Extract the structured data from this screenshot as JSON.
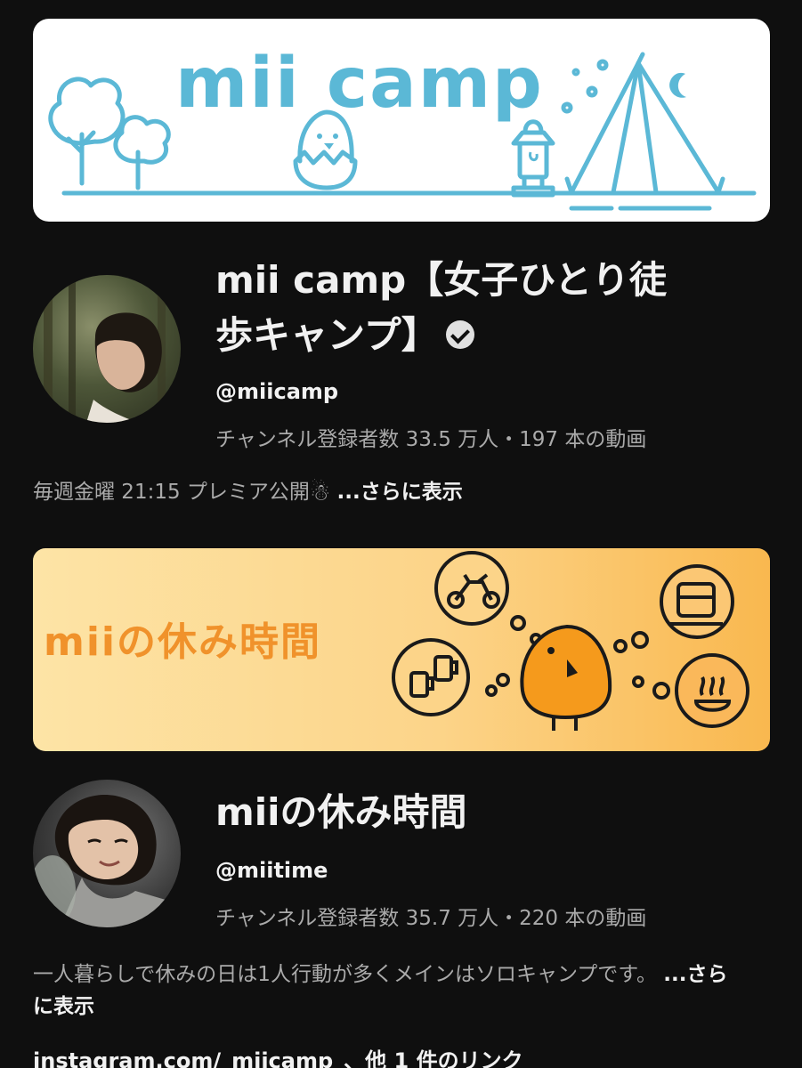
{
  "channels": [
    {
      "banner_text": "mii camp",
      "name_line1": "mii camp【女子ひとり徒",
      "name_line2": "歩キャンプ】",
      "handle": "@miicamp",
      "stats": "チャンネル登録者数 33.5 万人・197 本の動画",
      "description": "毎週金曜 21:15 プレミア公開",
      "description_emoji": "☃",
      "more_label": "...さらに表示"
    },
    {
      "banner_text": "miiの休み時間",
      "name": "miiの休み時間",
      "handle": "@miitime",
      "stats": "チャンネル登録者数 35.7 万人・220 本の動画",
      "description": "一人暮らしで休みの日は1人行動が多くメインはソロキャンプです。",
      "more_label": "...さらに表示",
      "link_text": "instagram.com/_miicamp_",
      "link_more": "、他 1 件のリンク"
    }
  ],
  "icons": [
    "verified-badge-icon",
    "tree-icon",
    "chick-egg-icon",
    "lantern-icon",
    "tent-icon",
    "moon-icon",
    "motorcycle-icon",
    "train-icon",
    "beer-icon",
    "onsen-icon",
    "bird-mascot-icon"
  ],
  "colors": {
    "background": "#0f0f0f",
    "banner1_accent": "#5bb8d6",
    "banner2_accent": "#f0922b",
    "secondary_text": "#aaaaaa"
  }
}
